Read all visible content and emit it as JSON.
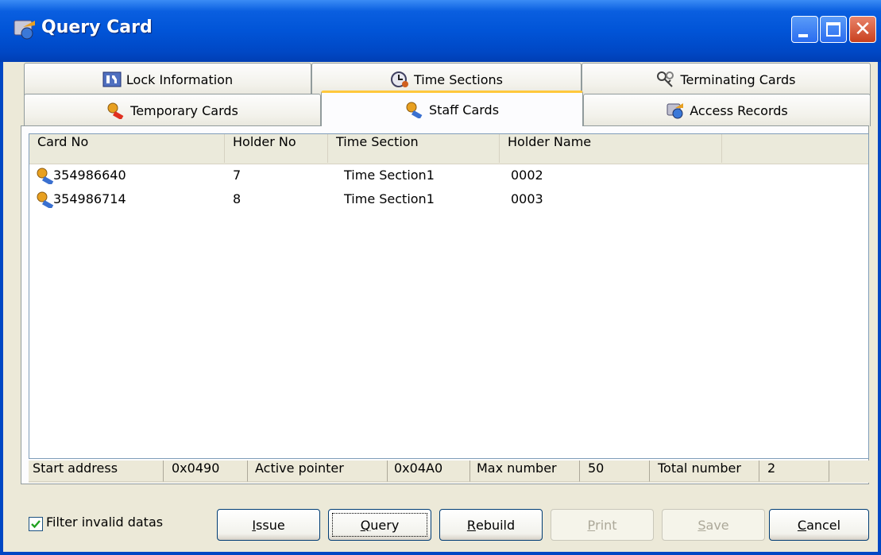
{
  "window": {
    "title": "Query Card"
  },
  "tabs": {
    "row1": [
      {
        "label": "Lock Information",
        "icon": "lock-info-icon"
      },
      {
        "label": "Time Sections",
        "icon": "clock-icon"
      },
      {
        "label": "Terminating Cards",
        "icon": "terminate-keys-icon"
      }
    ],
    "row2": [
      {
        "label": "Temporary Cards",
        "icon": "key-icon"
      },
      {
        "label": "Staff Cards",
        "icon": "key-icon",
        "active": true
      },
      {
        "label": "Access Records",
        "icon": "records-icon"
      }
    ]
  },
  "list": {
    "columns": [
      "Card No",
      "Holder No",
      "Time Section",
      "Holder Name"
    ],
    "rows": [
      {
        "card_no": "354986640",
        "holder_no": "7",
        "time_section": "Time Section1",
        "holder_name": "0002"
      },
      {
        "card_no": "354986714",
        "holder_no": "8",
        "time_section": "Time Section1",
        "holder_name": "0003"
      }
    ]
  },
  "status": {
    "start_address_label": "Start address",
    "start_address_value": "0x0490",
    "active_pointer_label": "Active pointer",
    "active_pointer_value": "0x04A0",
    "max_number_label": "Max number",
    "max_number_value": "50",
    "total_number_label": "Total number",
    "total_number_value": "2"
  },
  "filter": {
    "label": "Filter invalid datas",
    "checked": true
  },
  "buttons": {
    "issue": {
      "mnemonic": "I",
      "rest": "ssue"
    },
    "query": {
      "mnemonic": "Q",
      "rest": "uery"
    },
    "rebuild": {
      "mnemonic": "R",
      "rest": "ebuild"
    },
    "print": {
      "mnemonic": "P",
      "rest": "rint"
    },
    "save": {
      "mnemonic": "S",
      "rest": "ave"
    },
    "cancel": {
      "mnemonic": "C",
      "rest": "ancel"
    }
  },
  "colors": {
    "title_bar": "#0154d7",
    "active_tab_accent": "#ffc83c",
    "key_icon": "#e8a020"
  }
}
